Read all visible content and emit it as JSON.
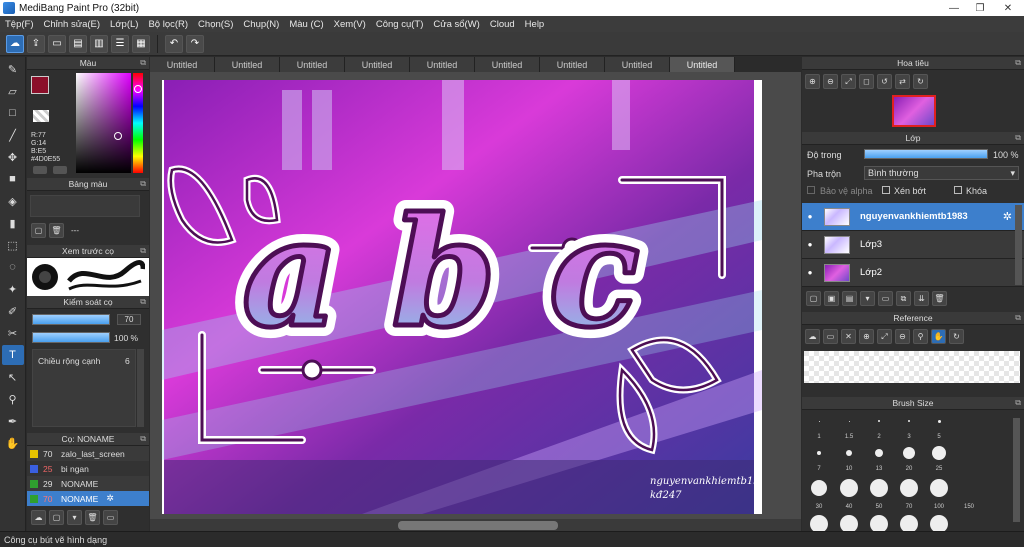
{
  "window": {
    "title": "MediBang Paint Pro (32bit)"
  },
  "menu": [
    "Tệp(F)",
    "Chỉnh sửa(E)",
    "Lớp(L)",
    "Bộ lọc(R)",
    "Chọn(S)",
    "Chụp(N)",
    "Màu (C)",
    "Xem(V)",
    "Công cụ(T)",
    "Cửa sổ(W)",
    "Cloud",
    "Help"
  ],
  "color_panel": {
    "title": "Màu",
    "r": "R:77",
    "g": "G:14",
    "b": "B:E5",
    "hex": "#4D0E55",
    "primary": "#8b0f2a",
    "secondary": "#ffffff"
  },
  "palette_panel": {
    "title": "Bảng màu",
    "value": "---"
  },
  "brush_preview": {
    "title": "Xem trước cọ"
  },
  "brush_control": {
    "title": "Kiểm soát cọ",
    "size": "70",
    "opacity": "100 %",
    "width_label": "Chiều rộng cạnh",
    "width_value": "6"
  },
  "brush_list": {
    "title": "Cọ: NONAME",
    "items": [
      {
        "size": "70",
        "name": "zalo_last_screen",
        "color": "#e6c200",
        "selected": false
      },
      {
        "size": "25",
        "name": "bi ngan",
        "color": "#3a5fe0",
        "selected": false
      },
      {
        "size": "29",
        "name": "NONAME",
        "color": "#2fa02f",
        "selected": false
      },
      {
        "size": "70",
        "name": "NONAME",
        "color": "#2fa02f",
        "selected": true
      }
    ]
  },
  "tabs": [
    "Untitled",
    "Untitled",
    "Untitled",
    "Untitled",
    "Untitled",
    "Untitled",
    "Untitled",
    "Untitled",
    "Untitled"
  ],
  "canvas": {
    "text": "a b c",
    "watermark1": "nguyenvankhiemtb1983",
    "watermark2": "kđ247"
  },
  "navigator": {
    "title": "Hoa tiêu"
  },
  "layer_panel": {
    "title": "Lớp",
    "opacity_label": "Độ trong",
    "opacity_value": "100 %",
    "blend_label": "Pha trộn",
    "blend_value": "Bình thường",
    "protect_alpha": "Bảo vệ alpha",
    "clip": "Xén bớt",
    "lock": "Khóa",
    "layers": [
      {
        "name": "nguyenvankhiemtb1983",
        "selected": true
      },
      {
        "name": "Lớp3",
        "selected": false
      },
      {
        "name": "Lớp2",
        "selected": false
      }
    ]
  },
  "reference": {
    "title": "Reference"
  },
  "brush_size": {
    "title": "Brush Size",
    "labels": [
      "1",
      "1.5",
      "2",
      "3",
      "5",
      "7",
      "10",
      "13",
      "20",
      "25",
      "30",
      "40",
      "50",
      "70",
      "100",
      "150"
    ]
  },
  "status": {
    "text": "Công cụ bút vẽ hình dạng"
  }
}
